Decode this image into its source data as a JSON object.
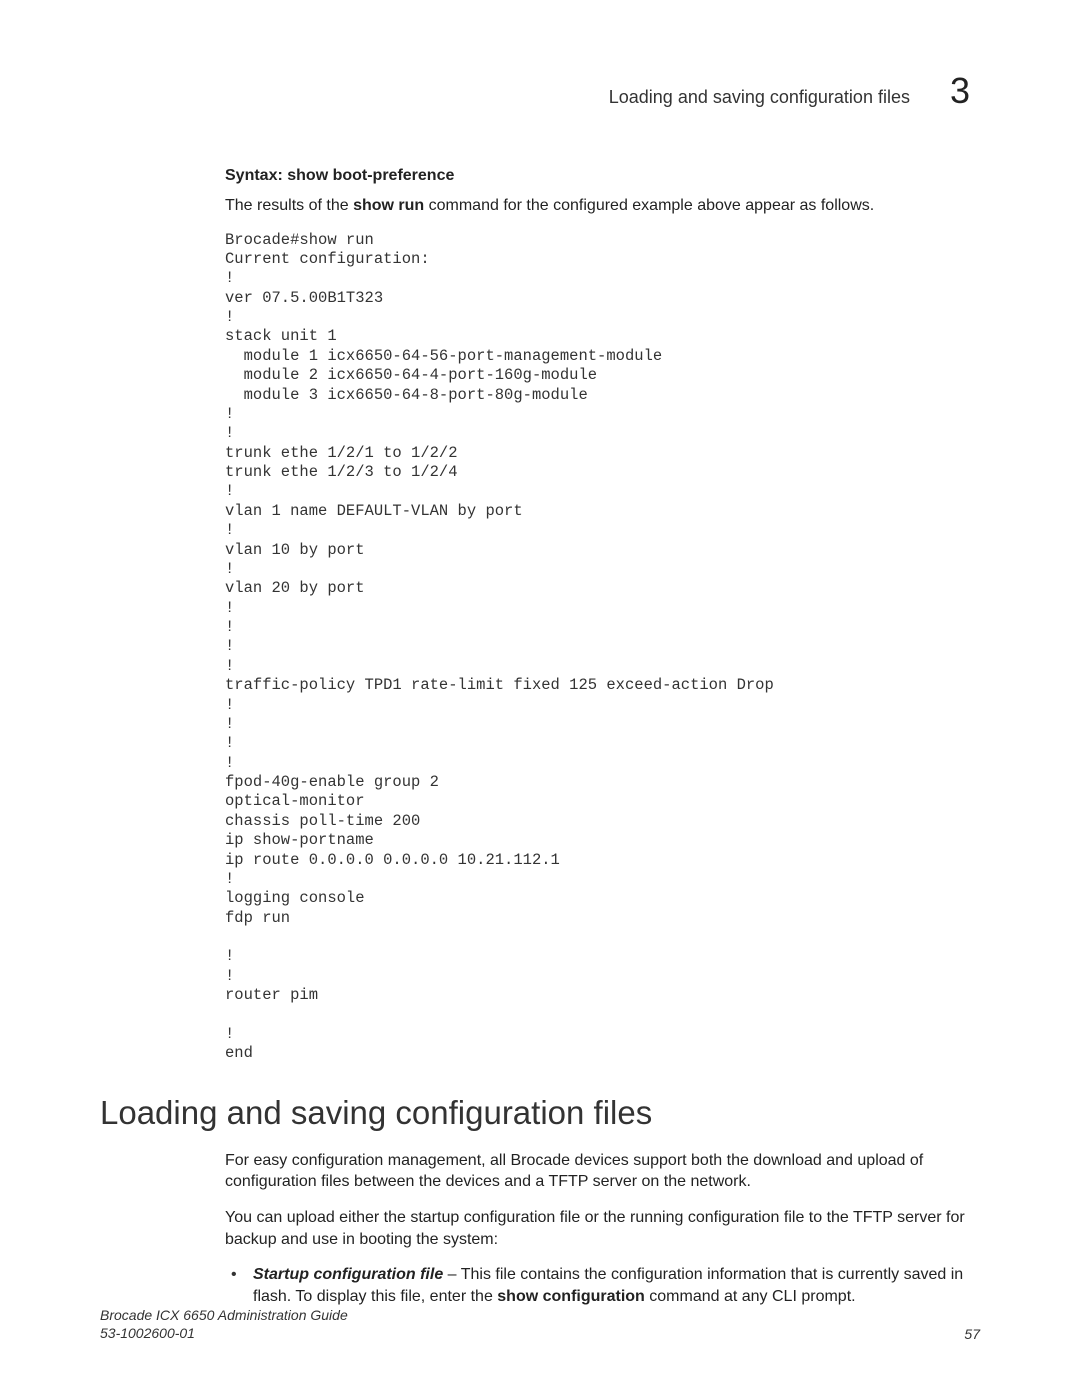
{
  "header": {
    "title": "Loading and saving configuration files",
    "chapter_number": "3"
  },
  "syntax_line": "Syntax:  show boot-preference",
  "intro_parts": {
    "before": "The results of the ",
    "bold": "show run",
    "after": " command for the configured example above appear as follows."
  },
  "code": "Brocade#show run\nCurrent configuration:\n!\nver 07.5.00B1T323\n!\nstack unit 1\n  module 1 icx6650-64-56-port-management-module\n  module 2 icx6650-64-4-port-160g-module\n  module 3 icx6650-64-8-port-80g-module\n!\n!\ntrunk ethe 1/2/1 to 1/2/2\ntrunk ethe 1/2/3 to 1/2/4\n!\nvlan 1 name DEFAULT-VLAN by port\n!\nvlan 10 by port\n!\nvlan 20 by port\n!\n!\n!\n!\ntraffic-policy TPD1 rate-limit fixed 125 exceed-action Drop\n!\n!\n!\n!\nfpod-40g-enable group 2\noptical-monitor\nchassis poll-time 200\nip show-portname\nip route 0.0.0.0 0.0.0.0 10.21.112.1\n!\nlogging console\nfdp run\n\n!\n!\nrouter pim\n\n!\nend",
  "section_heading": "Loading and saving configuration files",
  "para1": "For easy configuration management, all Brocade devices support both the download and upload of configuration files between the devices and a TFTP server on the network.",
  "para2": "You can upload either the startup configuration file or the running configuration file to the TFTP server for backup and use in booting the system:",
  "bullet1_parts": {
    "lead_bold_ital": "Startup configuration file",
    "mid1": " – This file contains the configuration information that is currently saved in flash.  To display this file, enter the ",
    "bold2": "show configuration",
    "tail": " command at any CLI prompt."
  },
  "footer": {
    "guide": "Brocade ICX 6650 Administration Guide",
    "docnum": "53-1002600-01",
    "page": "57"
  }
}
